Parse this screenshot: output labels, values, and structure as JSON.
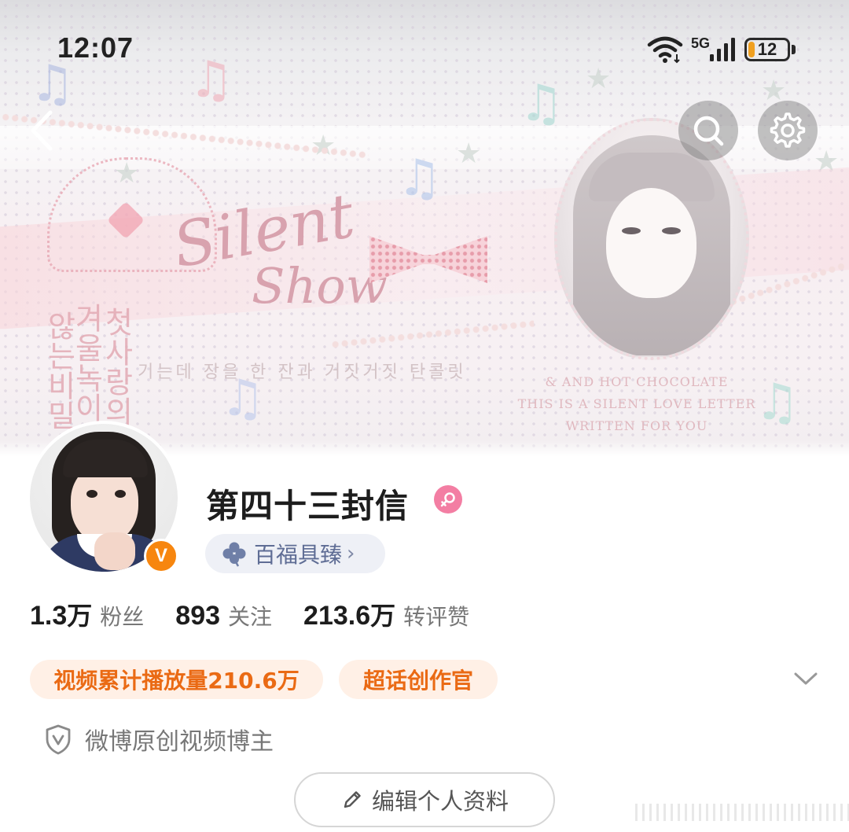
{
  "status_bar": {
    "time": "12:07",
    "network": "5G",
    "battery": "12",
    "battery_color": "#f0a020"
  },
  "nav": {
    "back_icon": "chevron-left-icon",
    "search_icon": "search-icon",
    "settings_icon": "gear-icon"
  },
  "banner": {
    "script_title_1": "Silent",
    "script_title_2": "Show",
    "korean_1": "첫사랑의",
    "korean_2": "겨울녹이기",
    "korean_3": "않는비밀",
    "handwriting": "기는데 장을 한 잔과 거짓거짓 탄콜릿",
    "english_1": "& AND HOT CHOCOLATE",
    "english_2": "THIS IS A SILENT LOVE LETTER",
    "english_3": "WRITTEN FOR YOU"
  },
  "profile": {
    "username": "第四十三封信",
    "verified_badge": "V",
    "verified_color": "#f7860f",
    "gender_icon": "female-icon",
    "gender_color": "#f37ea3",
    "fortune_icon": "clover-icon",
    "fortune_label": "百福具臻",
    "fortune_chevron": "›"
  },
  "stats": [
    {
      "value": "1.3",
      "unit": "万",
      "label": "粉丝"
    },
    {
      "value": "893",
      "unit": "",
      "label": "关注"
    },
    {
      "value": "213.6",
      "unit": "万",
      "label": "转评赞"
    }
  ],
  "tags": {
    "tag1": "视频累计播放量210.6万",
    "tag2": "超话创作官",
    "accent": "#ea6a14",
    "expand_icon": "chevron-down-icon"
  },
  "certification": {
    "icon": "shield-v-icon",
    "label": "微博原创视频博主"
  },
  "edit_profile": {
    "icon": "pencil-icon",
    "label": "编辑个人资料"
  }
}
